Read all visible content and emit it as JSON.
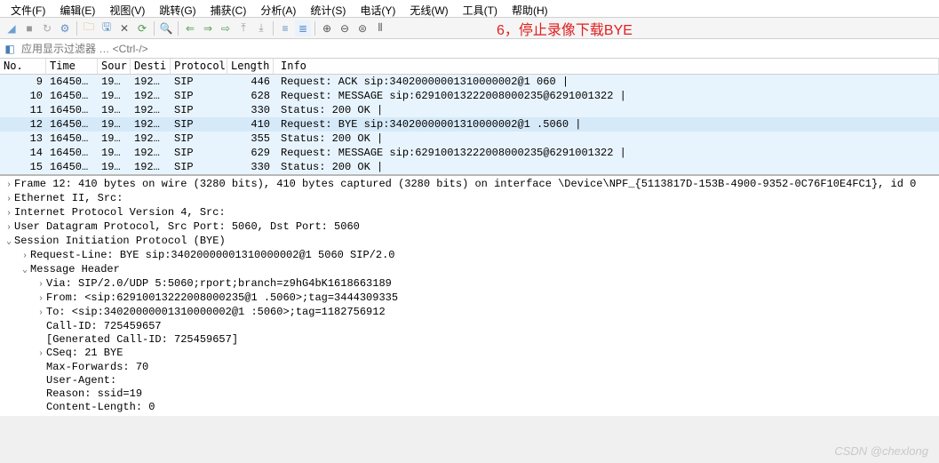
{
  "menu": {
    "items": [
      "文件(F)",
      "编辑(E)",
      "视图(V)",
      "跳转(G)",
      "捕获(C)",
      "分析(A)",
      "统计(S)",
      "电话(Y)",
      "无线(W)",
      "工具(T)",
      "帮助(H)"
    ]
  },
  "toolbar": {
    "icons": [
      "folder-icon",
      "save-icon",
      "close-icon",
      "reload-icon",
      "find-icon",
      "back-icon",
      "forward-icon",
      "jump-icon",
      "goto-last-icon",
      "autoscroll-icon",
      "colorize-icon",
      "zoom-in-icon",
      "zoom-out-icon",
      "zoom-reset-icon",
      "resize-cols-icon",
      "columns-icon"
    ],
    "annotation": "6，停止录像下载BYE"
  },
  "filter": {
    "placeholder": "应用显示过滤器 … <Ctrl-/>"
  },
  "packet_columns": [
    "No.",
    "Time",
    "Sour",
    "Desti",
    "Protocol",
    "Length",
    "Info"
  ],
  "packets": [
    {
      "no": "9",
      "time": "16450…",
      "src": "19…",
      "dst": "192…",
      "proto": "SIP",
      "len": "446",
      "info": "Request: ACK sip:34020000001310000002@1             060 |"
    },
    {
      "no": "10",
      "time": "16450…",
      "src": "19…",
      "dst": "192…",
      "proto": "SIP",
      "len": "628",
      "info": "Request: MESSAGE sip:62910013222008000235@6291001322 |"
    },
    {
      "no": "11",
      "time": "16450…",
      "src": "19…",
      "dst": "192…",
      "proto": "SIP",
      "len": "330",
      "info": "Status: 200 OK |"
    },
    {
      "no": "12",
      "time": "16450…",
      "src": "19…",
      "dst": "192…",
      "proto": "SIP",
      "len": "410",
      "info": "Request: BYE sip:34020000001310000002@1            .5060 |",
      "selected": true
    },
    {
      "no": "13",
      "time": "16450…",
      "src": "19…",
      "dst": "192…",
      "proto": "SIP",
      "len": "355",
      "info": "Status: 200 OK |"
    },
    {
      "no": "14",
      "time": "16450…",
      "src": "19…",
      "dst": "192…",
      "proto": "SIP",
      "len": "629",
      "info": "Request: MESSAGE sip:62910013222008000235@6291001322 |"
    },
    {
      "no": "15",
      "time": "16450…",
      "src": "19…",
      "dst": "192…",
      "proto": "SIP",
      "len": "330",
      "info": "Status: 200 OK |"
    }
  ],
  "details": [
    {
      "indent": 0,
      "toggle": ">",
      "text": "Frame 12: 410 bytes on wire (3280 bits), 410 bytes captured (3280 bits) on interface \\Device\\NPF_{5113817D-153B-4900-9352-0C76F10E4FC1}, id 0"
    },
    {
      "indent": 0,
      "toggle": ">",
      "text": "Ethernet II, Src: "
    },
    {
      "indent": 0,
      "toggle": ">",
      "text": "Internet Protocol Version 4, Src: "
    },
    {
      "indent": 0,
      "toggle": ">",
      "text": "User Datagram Protocol, Src Port: 5060, Dst Port: 5060"
    },
    {
      "indent": 0,
      "toggle": "v",
      "text": "Session Initiation Protocol (BYE)"
    },
    {
      "indent": 1,
      "toggle": ">",
      "text": "Request-Line: BYE sip:34020000001310000002@1         5060 SIP/2.0"
    },
    {
      "indent": 1,
      "toggle": "v",
      "text": "Message Header"
    },
    {
      "indent": 2,
      "toggle": ">",
      "text": "Via: SIP/2.0/UDP          5:5060;rport;branch=z9hG4bK1618663189"
    },
    {
      "indent": 2,
      "toggle": ">",
      "text": "From: <sip:62910013222008000235@1         .5060>;tag=3444309335"
    },
    {
      "indent": 2,
      "toggle": ">",
      "text": "To: <sip:34020000001310000002@1          :5060>;tag=1182756912"
    },
    {
      "indent": 2,
      "toggle": "",
      "text": "Call-ID: 725459657"
    },
    {
      "indent": 2,
      "toggle": "",
      "text": "[Generated Call-ID: 725459657]"
    },
    {
      "indent": 2,
      "toggle": ">",
      "text": "CSeq: 21 BYE"
    },
    {
      "indent": 2,
      "toggle": "",
      "text": "Max-Forwards: 70"
    },
    {
      "indent": 2,
      "toggle": "",
      "text": "User-Agent: "
    },
    {
      "indent": 2,
      "toggle": "",
      "text": "Reason: ssid=19"
    },
    {
      "indent": 2,
      "toggle": "",
      "text": "Content-Length: 0"
    }
  ],
  "watermark": "CSDN @chexlong"
}
